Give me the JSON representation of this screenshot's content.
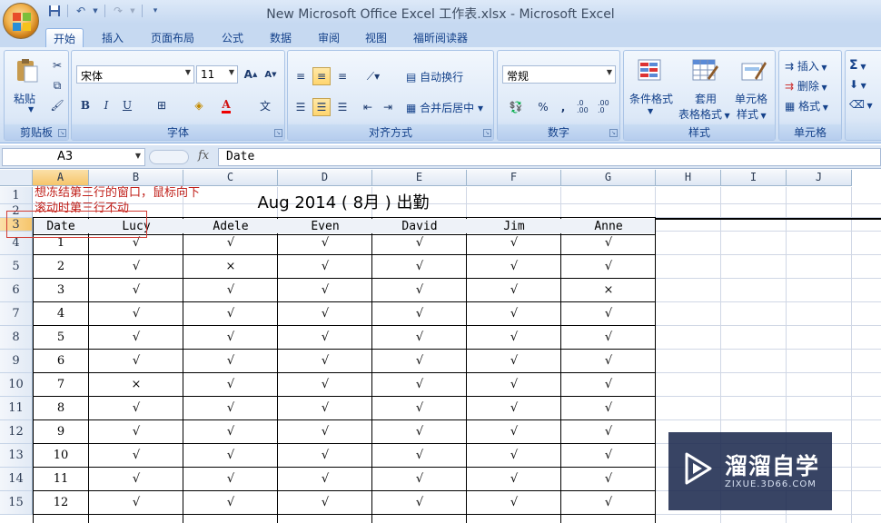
{
  "window": {
    "title": "New Microsoft Office Excel 工作表.xlsx - Microsoft Excel"
  },
  "quick_access": [
    "save-icon",
    "undo-icon",
    "redo-icon",
    "customize-icon"
  ],
  "tabs": [
    {
      "label": "开始",
      "active": true
    },
    {
      "label": "插入"
    },
    {
      "label": "页面布局"
    },
    {
      "label": "公式"
    },
    {
      "label": "数据"
    },
    {
      "label": "审阅"
    },
    {
      "label": "视图"
    },
    {
      "label": "福昕阅读器"
    }
  ],
  "ribbon": {
    "clipboard": {
      "paste": "粘贴",
      "label": "剪贴板"
    },
    "font": {
      "name": "宋体",
      "size": "11",
      "label": "字体",
      "grow": "A",
      "shrink": "A",
      "bold": "B",
      "italic": "I",
      "underline": "U",
      "color_letter": "A",
      "phonetic": "文"
    },
    "alignment": {
      "wrap": "自动换行",
      "merge": "合并后居中",
      "label": "对齐方式"
    },
    "number": {
      "format": "常规",
      "percent": "%",
      "comma": ",",
      "inc": ".0 .00",
      "dec": ".00 .0",
      "label": "数字"
    },
    "styles": {
      "conditional": "条件格式",
      "table_1": "套用",
      "table_2": "表格格式",
      "cell_1": "单元格",
      "cell_2": "样式",
      "label": "样式"
    },
    "cells": {
      "insert": "插入",
      "delete": "删除",
      "format": "格式",
      "label": "单元格"
    },
    "editing": {
      "sum": "Σ"
    }
  },
  "formula_bar": {
    "name_box": "A3",
    "fx": "fx",
    "content": "Date"
  },
  "columns": [
    "A",
    "B",
    "C",
    "D",
    "E",
    "F",
    "G",
    "H",
    "I",
    "J"
  ],
  "rows": [
    "1",
    "2",
    "3",
    "4",
    "5",
    "6",
    "7",
    "8",
    "9",
    "10",
    "11",
    "12",
    "13",
    "14",
    "15"
  ],
  "sheet": {
    "title": "Aug  2014 ( 8月 ) 出勤",
    "note_line1": "想冻结第三行的窗口，鼠标向下",
    "note_line2": "滚动时第三行不动",
    "headers": [
      "Date",
      "Lucy",
      "Adele",
      "Even",
      "David",
      "Jim",
      "Anne"
    ],
    "data": [
      [
        "1",
        "√",
        "√",
        "√",
        "√",
        "√",
        "√"
      ],
      [
        "2",
        "√",
        "×",
        "√",
        "√",
        "√",
        "√"
      ],
      [
        "3",
        "√",
        "√",
        "√",
        "√",
        "√",
        "×"
      ],
      [
        "4",
        "√",
        "√",
        "√",
        "√",
        "√",
        "√"
      ],
      [
        "5",
        "√",
        "√",
        "√",
        "√",
        "√",
        "√"
      ],
      [
        "6",
        "√",
        "√",
        "√",
        "√",
        "√",
        "√"
      ],
      [
        "7",
        "×",
        "√",
        "√",
        "√",
        "√",
        "√"
      ],
      [
        "8",
        "√",
        "√",
        "√",
        "√",
        "√",
        "√"
      ],
      [
        "9",
        "√",
        "√",
        "√",
        "√",
        "√",
        "√"
      ],
      [
        "10",
        "√",
        "√",
        "√",
        "√",
        "√",
        "√"
      ],
      [
        "11",
        "√",
        "√",
        "√",
        "√",
        "√",
        "√"
      ],
      [
        "12",
        "√",
        "√",
        "√",
        "√",
        "√",
        "√"
      ]
    ]
  },
  "watermark": {
    "brand": "溜溜自学",
    "url": "ZIXUE.3D66.COM"
  }
}
